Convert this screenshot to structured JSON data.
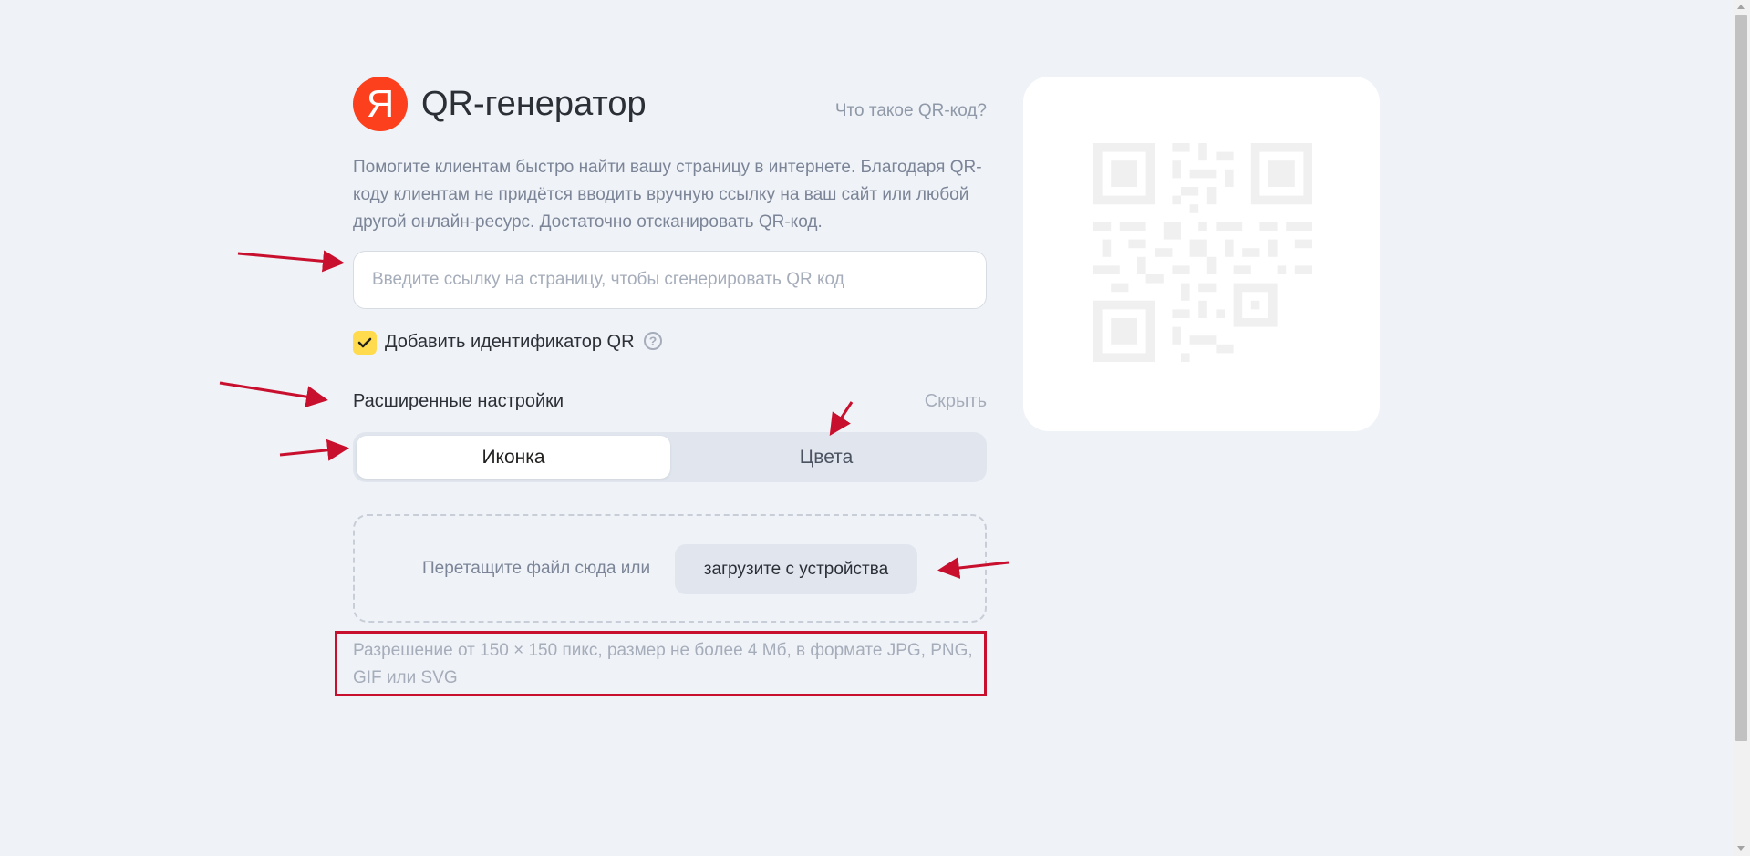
{
  "header": {
    "logo_letter": "Я",
    "title": "QR-генератор",
    "what_is_link": "Что такое QR-код?"
  },
  "description": "Помогите клиентам быстро найти вашу страницу в интернете. Благодаря QR-коду клиентам не придётся вводить вручную ссылку на ваш сайт или любой другой онлайн-ресурс. Достаточно отсканировать QR-код.",
  "url_input": {
    "value": "",
    "placeholder": "Введите ссылку на страницу, чтобы сгенерировать QR код"
  },
  "qr_id_checkbox": {
    "label": "Добавить идентификатор QR",
    "checked": true,
    "help_icon": "?"
  },
  "advanced": {
    "title": "Расширенные настройки",
    "hide_link": "Скрыть",
    "tabs": [
      {
        "label": "Иконка",
        "active": true
      },
      {
        "label": "Цвета",
        "active": false
      }
    ]
  },
  "upload": {
    "drop_text": "Перетащите файл сюда или",
    "button_label": "загрузите с устройства",
    "hint": "Разрешение от 150 × 150 пикс, размер не более 4 Мб, в формате JPG, PNG, GIF или SVG"
  },
  "colors": {
    "brand_red": "#fc3f1d",
    "checkbox_yellow": "#ffdb4d",
    "annotation_red": "#c8102e",
    "background": "#eff2f7"
  },
  "icons": {
    "logo": "yandex-logo-icon",
    "check": "check-icon",
    "help": "question-circle-icon",
    "qr": "qr-code-placeholder-icon"
  }
}
